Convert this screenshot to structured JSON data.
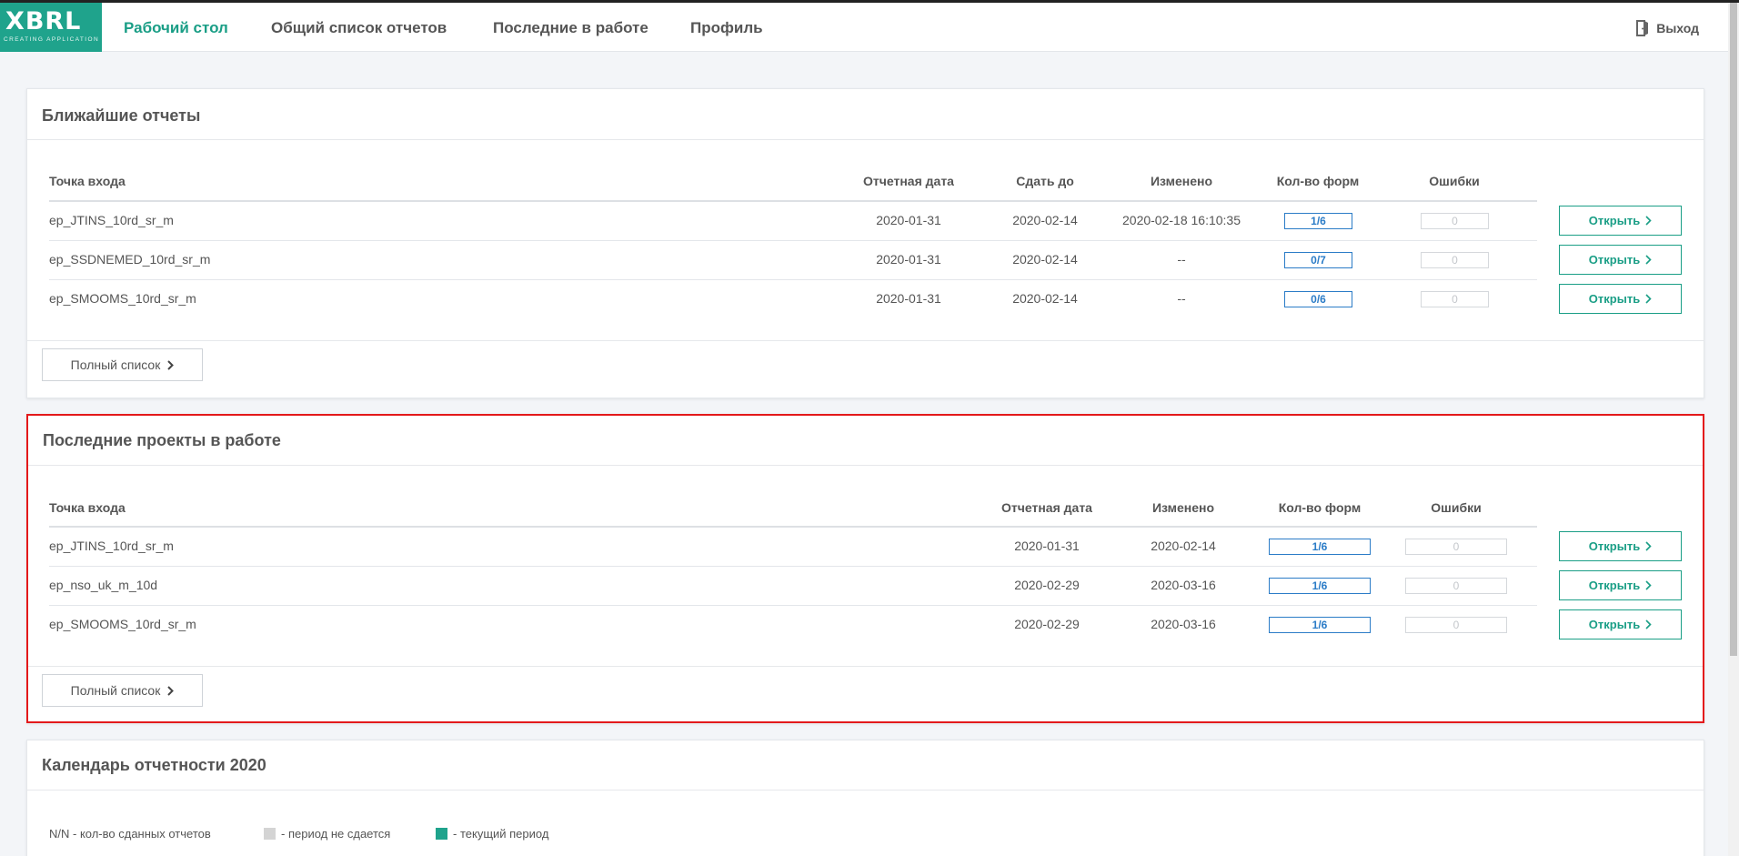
{
  "logo": {
    "main": "XBRL",
    "sub": "CREATING APPLICATION",
    "color": "#1fa38c"
  },
  "nav": {
    "items": [
      "Рабочий стол",
      "Общий список отчетов",
      "Последние в работе",
      "Профиль"
    ],
    "active": "Рабочий стол",
    "logout": "Выход"
  },
  "colors": {
    "accent": "#1a9e86",
    "badge": "#2b7cc7",
    "highlight": "#e3191b"
  },
  "nearest": {
    "title": "Ближайшие отчеты",
    "headers": {
      "entry": "Точка входа",
      "date": "Отчетная дата",
      "due": "Сдать до",
      "changed": "Изменено",
      "forms": "Кол-во форм",
      "errors": "Ошибки"
    },
    "rows": [
      {
        "entry": "ep_JTINS_10rd_sr_m",
        "date": "2020-01-31",
        "due": "2020-02-14",
        "changed": "2020-02-18 16:10:35",
        "forms": "1/6",
        "errors": "0",
        "action": "Открыть"
      },
      {
        "entry": "ep_SSDNEMED_10rd_sr_m",
        "date": "2020-01-31",
        "due": "2020-02-14",
        "changed": "--",
        "forms": "0/7",
        "errors": "0",
        "action": "Открыть"
      },
      {
        "entry": "ep_SMOOMS_10rd_sr_m",
        "date": "2020-01-31",
        "due": "2020-02-14",
        "changed": "--",
        "forms": "0/6",
        "errors": "0",
        "action": "Открыть"
      }
    ],
    "full_list": "Полный список"
  },
  "recent": {
    "title": "Последние проекты в работе",
    "headers": {
      "entry": "Точка входа",
      "date": "Отчетная дата",
      "changed": "Изменено",
      "forms": "Кол-во форм",
      "errors": "Ошибки"
    },
    "rows": [
      {
        "entry": "ep_JTINS_10rd_sr_m",
        "date": "2020-01-31",
        "changed": "2020-02-14",
        "forms": "1/6",
        "errors": "0",
        "action": "Открыть"
      },
      {
        "entry": "ep_nso_uk_m_10d",
        "date": "2020-02-29",
        "changed": "2020-03-16",
        "forms": "1/6",
        "errors": "0",
        "action": "Открыть"
      },
      {
        "entry": "ep_SMOOMS_10rd_sr_m",
        "date": "2020-02-29",
        "changed": "2020-03-16",
        "forms": "1/6",
        "errors": "0",
        "action": "Открыть"
      }
    ],
    "full_list": "Полный список"
  },
  "calendar": {
    "title": "Календарь отчетности 2020",
    "legend": {
      "count": "N/N - кол-во сданных отчетов",
      "not_due": "- период не сдается",
      "current": "- текущий период",
      "not_due_color": "#d4d4d4",
      "current_color": "#1fa38c"
    }
  }
}
